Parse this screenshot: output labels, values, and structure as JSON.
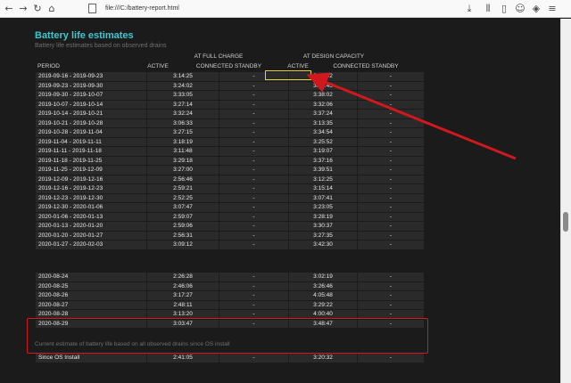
{
  "browser": {
    "url": "file:///C:/battery-report.html"
  },
  "report": {
    "title": "Battery life estimates",
    "subtitle": "Battery life estimates based on observed drains",
    "group_headers": [
      "AT FULL CHARGE",
      "AT DESIGN CAPACITY"
    ],
    "columns": [
      "PERIOD",
      "ACTIVE",
      "CONNECTED STANDBY",
      "ACTIVE",
      "CONNECTED STANDBY"
    ],
    "rows": [
      [
        "2019-09-16 - 2019-09-23",
        "3:14:25",
        "-",
        "3:16:42",
        "-"
      ],
      [
        "2019-09-23 - 2019-09-30",
        "3:24:02",
        "-",
        "3:28:45",
        "-"
      ],
      [
        "2019-09-30 - 2019-10-07",
        "3:33:05",
        "-",
        "3:38:02",
        "-"
      ],
      [
        "2019-10-07 - 2019-10-14",
        "3:27:14",
        "-",
        "3:32:06",
        "-"
      ],
      [
        "2019-10-14 - 2019-10-21",
        "3:32:24",
        "-",
        "3:37:24",
        "-"
      ],
      [
        "2019-10-21 - 2019-10-28",
        "3:06:33",
        "-",
        "3:13:35",
        "-"
      ],
      [
        "2019-10-28 - 2019-11-04",
        "3:27:15",
        "-",
        "3:34:54",
        "-"
      ],
      [
        "2019-11-04 - 2019-11-11",
        "3:18:19",
        "-",
        "3:25:52",
        "-"
      ],
      [
        "2019-11-11 - 2019-11-18",
        "3:11:48",
        "-",
        "3:19:07",
        "-"
      ],
      [
        "2019-11-18 - 2019-11-25",
        "3:29:18",
        "-",
        "3:37:16",
        "-"
      ],
      [
        "2019-11-25 - 2019-12-09",
        "3:27:00",
        "-",
        "3:39:51",
        "-"
      ],
      [
        "2019-12-09 - 2019-12-16",
        "2:56:46",
        "-",
        "3:12:25",
        "-"
      ],
      [
        "2019-12-16 - 2019-12-23",
        "2:59:21",
        "-",
        "3:15:14",
        "-"
      ],
      [
        "2019-12-23 - 2019-12-30",
        "2:52:25",
        "-",
        "3:07:41",
        "-"
      ],
      [
        "2019-12-30 - 2020-01-06",
        "3:07:47",
        "-",
        "3:23:05",
        "-"
      ],
      [
        "2020-01-06 - 2020-01-13",
        "2:59:07",
        "-",
        "3:28:19",
        "-"
      ],
      [
        "2020-01-13 - 2020-01-20",
        "2:59:06",
        "-",
        "3:30:37",
        "-"
      ],
      [
        "2020-01-20 - 2020-01-27",
        "2:56:31",
        "-",
        "3:27:35",
        "-"
      ],
      [
        "2020-01-27 - 2020-02-03",
        "3:09:12",
        "-",
        "3:42:30",
        "-"
      ]
    ],
    "rows2": [
      [
        "2020-08-24",
        "2:26:28",
        "-",
        "3:02:19",
        "-"
      ],
      [
        "2020-08-25",
        "2:46:06",
        "-",
        "3:26:46",
        "-"
      ],
      [
        "2020-08-26",
        "3:17:27",
        "-",
        "4:05:48",
        "-"
      ],
      [
        "2020-08-27",
        "2:48:11",
        "-",
        "3:29:22",
        "-"
      ],
      [
        "2020-08-28",
        "3:13:20",
        "-",
        "4:00:40",
        "-"
      ],
      [
        "2020-08-29",
        "3:03:47",
        "-",
        "3:48:47",
        "-"
      ]
    ],
    "footer_label": "Current estimate of battery life based on all observed drains since OS install",
    "since_install": [
      "Since OS Install",
      "2:41:05",
      "-",
      "3:20:32",
      "-"
    ]
  },
  "annotation_colors": {
    "box": "#d0181e",
    "arrow": "#d0181e",
    "highlight": "#e8d23a",
    "title": "#3fc6cf"
  }
}
